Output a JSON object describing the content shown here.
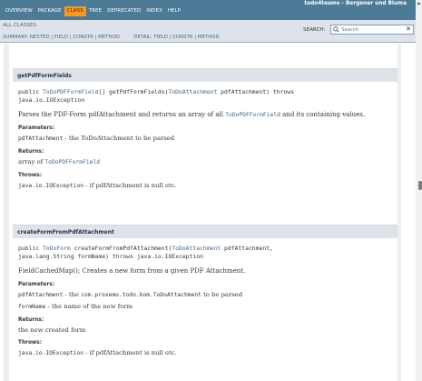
{
  "header": {
    "brand": "todo4teams - Bergener und Bluma",
    "nav": [
      "OVERVIEW",
      "PACKAGE",
      "CLASS",
      "TREE",
      "DEPRECATED",
      "INDEX",
      "HELP"
    ],
    "active_nav": "CLASS"
  },
  "subnav": {
    "all_classes": "ALL CLASSES",
    "summary_prefix": "SUMMARY: NESTED | ",
    "summary_field": "FIELD",
    "summary_sep1": " | ",
    "summary_constr": "CONSTR",
    "summary_sep2": " | ",
    "summary_method": "METHOD",
    "detail_prefix": "DETAIL: ",
    "detail_field": "FIELD",
    "detail_sep1": " | ",
    "detail_constr": "CONSTR",
    "detail_sep2": " | ",
    "detail_method": "METHOD",
    "search_label": "SEARCH:",
    "search_placeholder": "Search"
  },
  "methods": [
    {
      "name": "getPdfFormFields",
      "sig_line1_pre": "public ",
      "sig_line1_type": "ToDoPDFFormField",
      "sig_line1_mid": "[] getPdfFormFields(",
      "sig_line1_param": "ToDoAttachment",
      "sig_line1_post": " pdfAttachment) throws",
      "sig_line2": "java.io.IOException",
      "desc_pre": "Parses the PDF-Form pdfAttachment and returns an array of all ",
      "desc_code": "ToDoPDFFormField",
      "desc_post": " and its containing values.",
      "params_label": "Parameters:",
      "param1_name": "pdfAttachment",
      "param1_desc": " - the ToDoAttachment to be parsed",
      "returns_label": "Returns:",
      "returns_pre": "array of ",
      "returns_code": "ToDoPDFFormField",
      "throws_label": "Throws:",
      "throws_code": "java.io.IOException",
      "throws_desc": " - if pdfAttachment is null etc."
    },
    {
      "name": "createFormFromPdfAttachment",
      "sig_line1_pre": "public ",
      "sig_line1_type": "ToDoForm",
      "sig_line1_mid": " createFormFromPdfAttachment(",
      "sig_line1_param": "ToDoAttachment",
      "sig_line1_post": " pdfAttachment,",
      "sig_line2": "java.lang.String formName) throws java.io.IOException",
      "desc_text": "FieldCachedMap(); Creates a new form from a given PDF Attachment.",
      "params_label": "Parameters:",
      "param1_name": "pdfAttachment",
      "param1_mid": " - the ",
      "param1_code": "com.proxemo.todo.bom.ToDoAttachment",
      "param1_desc": " to be parsed",
      "param2_name": "formName",
      "param2_desc": " - the name of the new form",
      "returns_label": "Returns:",
      "returns_text": "the new created form",
      "throws_label": "Throws:",
      "throws_code": "java.io.IOException",
      "throws_desc": " - if pdfAttachment is null etc."
    }
  ],
  "colors": {
    "nav_bg": "#4d7a97",
    "nav_active": "#f8981d",
    "subnav_bg": "#dee3e9",
    "link": "#4a6782"
  }
}
